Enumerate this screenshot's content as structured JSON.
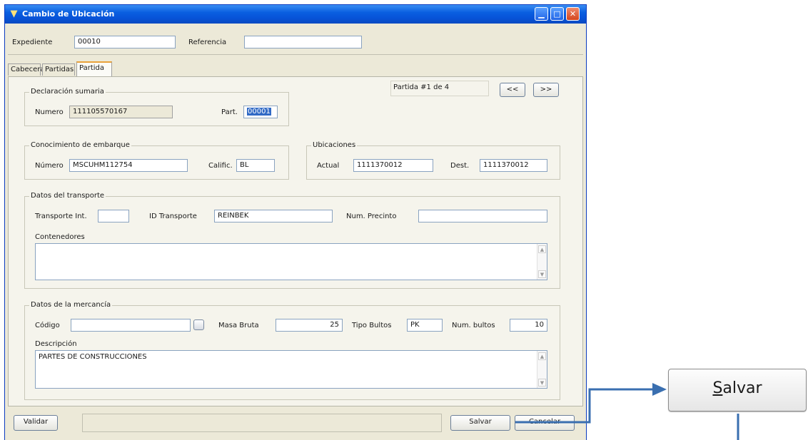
{
  "window": {
    "title": "Cambio de Ubicación",
    "icon": "app-logo-icon",
    "controls": [
      "minimize-icon",
      "maximize-icon",
      "close-icon"
    ]
  },
  "header": {
    "expediente_label": "Expediente",
    "expediente_value": "00010",
    "referencia_label": "Referencia",
    "referencia_value": ""
  },
  "tabs": [
    {
      "label": "Cabecera",
      "active": false
    },
    {
      "label": "Partidas",
      "active": false
    },
    {
      "label": "Partida",
      "active": true
    }
  ],
  "pager": {
    "text": "Partida #1 de 4",
    "prev_label": "<<",
    "next_label": ">>"
  },
  "declaracion": {
    "title": "Declaración sumaria",
    "numero_label": "Numero",
    "numero_value": "111105570167",
    "part_label": "Part.",
    "part_value": "00001"
  },
  "conocimiento": {
    "title": "Conocimiento de embarque",
    "numero_label": "Número",
    "numero_value": "MSCUHM112754",
    "calific_label": "Calific.",
    "calific_value": "BL"
  },
  "ubicaciones": {
    "title": "Ubicaciones",
    "actual_label": "Actual",
    "actual_value": "1111370012",
    "dest_label": "Dest.",
    "dest_value": "1111370012"
  },
  "transporte": {
    "title": "Datos del transporte",
    "transporte_int_label": "Transporte Int.",
    "transporte_int_value": "",
    "id_transporte_label": "ID Transporte",
    "id_transporte_value": "REINBEK",
    "num_precinto_label": "Num. Precinto",
    "num_precinto_value": "",
    "contenedores_label": "Contenedores",
    "contenedores_value": ""
  },
  "mercancia": {
    "title": "Datos de la mercancía",
    "codigo_label": "Código",
    "codigo_value": "",
    "masa_bruta_label": "Masa Bruta",
    "masa_bruta_value": "25",
    "tipo_bultos_label": "Tipo Bultos",
    "tipo_bultos_value": "PK",
    "num_bultos_label": "Num. bultos",
    "num_bultos_value": "10",
    "descripcion_label": "Descripción",
    "descripcion_value": "PARTES DE CONSTRUCCIONES"
  },
  "footer": {
    "validar_label": "Validar",
    "status_text": "",
    "salvar_label": "Salvar",
    "cancelar_label": "Cancelar"
  },
  "callout": {
    "label_first": "S",
    "label_rest": "alvar"
  },
  "colors": {
    "title_bar": "#0753d8",
    "selection": "#316ac5",
    "callout_arrow": "#3a6fb0"
  }
}
